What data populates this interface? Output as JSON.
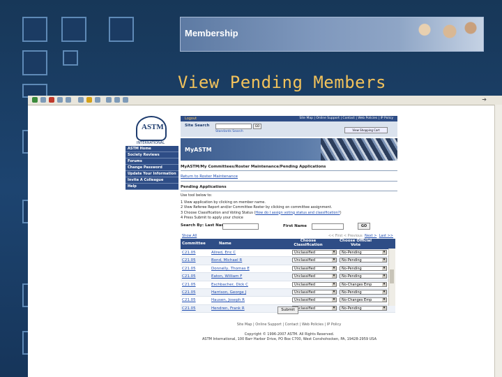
{
  "slide": {
    "banner_title": "Membership",
    "title": "View Pending Members"
  },
  "brand": {
    "logo_text": "ASTM",
    "logo_sub": "INTERNATIONAL"
  },
  "leftnav": [
    "ASTM Home",
    "Society Reviews",
    "Forums",
    "Change Password",
    "Update Your Information",
    "Invite A Colleague",
    "Help"
  ],
  "topbar": {
    "logout": "Logout",
    "links": "Site Map | Online Support | Contact | Web Policies | IP Policy"
  },
  "search": {
    "label": "Site Search",
    "go": "GO",
    "advanced": "Standards Search",
    "cart": "View Shopping Cart"
  },
  "hero": {
    "title": "MyASTM"
  },
  "breadcrumb": "MyASTM/My Committees/Roster Maintenance/Pending Applications",
  "return_link": "Return to Roster Maintenance",
  "section_title": "Pending Applications",
  "instructions": {
    "intro": "Use tool below to:",
    "step1": "1  View application by clicking on member name.",
    "step2": "2  View Referee Report and/or Committee Roster by clicking on committee assignment.",
    "step3_pre": "3  Choose Classification and Voting Status (",
    "step3_link": "How do I assign voting status and classification?",
    "step3_post": ")",
    "step4": "4  Press Submit to apply your choice"
  },
  "search_form": {
    "last_name_label": "Search By: Last Name",
    "first_name_label": "First Name",
    "go": "GO"
  },
  "pager": {
    "show_all": "Show All",
    "prev": "<< First  < Previous",
    "next": "Next >",
    "last": "Last >>"
  },
  "table": {
    "headers": {
      "committee": "Committee",
      "name": "Name",
      "classification": "Choose Classification",
      "vote": "Choose Official Vote"
    },
    "rows": [
      {
        "committee": "C21.05",
        "name": "Allred, Eric C",
        "classification": "Unclassified",
        "vote": "No-Pending"
      },
      {
        "committee": "C21.05",
        "name": "Bond, Michael R",
        "classification": "Unclassified",
        "vote": "No-Pending"
      },
      {
        "committee": "C21.05",
        "name": "Donnelly, Thomas E",
        "classification": "Unclassified",
        "vote": "No-Pending"
      },
      {
        "committee": "C21.05",
        "name": "Eaton, William F",
        "classification": "Unclassified",
        "vote": "No-Pending"
      },
      {
        "committee": "C21.05",
        "name": "Eschbacher, Dick C",
        "classification": "Unclassified",
        "vote": "No-Changes Emp"
      },
      {
        "committee": "C21.05",
        "name": "Harrison, George J",
        "classification": "Unclassified",
        "vote": "No-Pending"
      },
      {
        "committee": "C21.05",
        "name": "Hausen, Joseph R",
        "classification": "Unclassified",
        "vote": "No-Changes Emp"
      },
      {
        "committee": "C21.05",
        "name": "Hendren, Frank R",
        "classification": "Unclassified",
        "vote": "No-Pending"
      }
    ]
  },
  "submit": "Submit",
  "footer": {
    "links": "Site Map | Online Support | Contact | Web Policies | IP Policy",
    "copyright": "Copyright © 1996-2007 ASTM. All Rights Reserved.",
    "address": "ASTM International, 100 Barr Harbor Drive, PO Box C700, West Conshohocken, PA, 19428-2959 USA"
  }
}
